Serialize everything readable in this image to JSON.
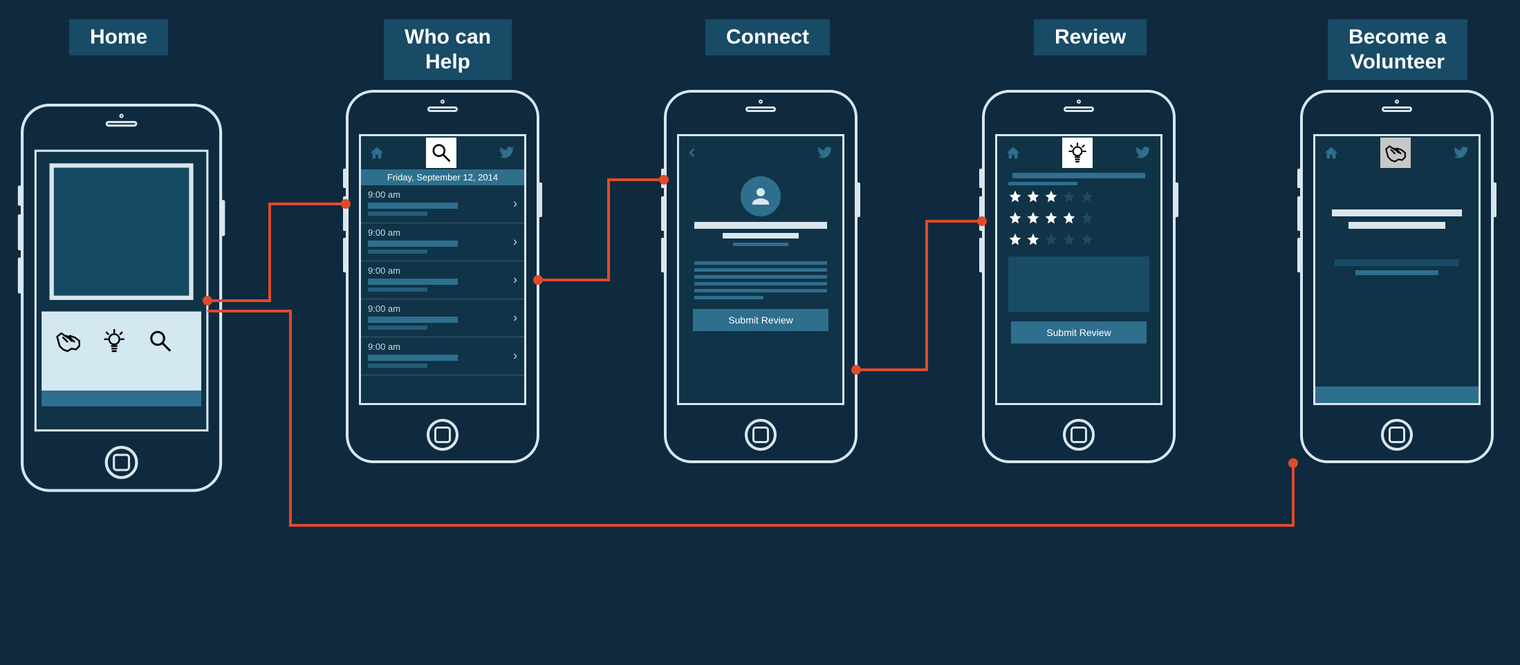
{
  "titles": {
    "home": "Home",
    "help": "Who can\nHelp",
    "connect": "Connect",
    "review": "Review",
    "volunteer": "Become a\nVolunteer"
  },
  "help_screen": {
    "date": "Friday, September 12, 2014",
    "rows": [
      {
        "time": "9:00 am"
      },
      {
        "time": "9:00 am"
      },
      {
        "time": "9:00 am"
      },
      {
        "time": "9:00 am"
      },
      {
        "time": "9:00 am"
      }
    ]
  },
  "connect_screen": {
    "submit_label": "Submit Review"
  },
  "review_screen": {
    "ratings": [
      3,
      4,
      2
    ],
    "max_stars": 5,
    "submit_label": "Submit Review"
  },
  "icons": {
    "home_topbar_center": "search-icon",
    "review_topbar_center": "lightbulb-icon",
    "volunteer_topbar_center": "handshake-icon",
    "home_iconbar": [
      "handshake-icon",
      "lightbulb-icon",
      "search-icon"
    ]
  }
}
